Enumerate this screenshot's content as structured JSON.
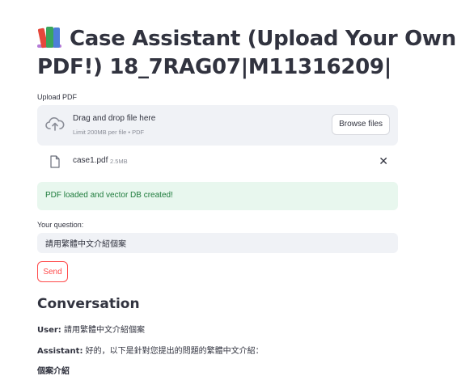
{
  "header": {
    "title": "Case Assistant (Upload Your Own PDF!) 18_7RAG07|M11316209|",
    "icon": "books-icon"
  },
  "upload": {
    "label": "Upload PDF",
    "drop_title": "Drag and drop file here",
    "drop_subtitle": "Limit 200MB per file • PDF",
    "browse_label": "Browse files",
    "file": {
      "name": "case1.pdf",
      "size": "2.5MB"
    }
  },
  "status": {
    "message": "PDF loaded and vector DB created!",
    "color": "#1e7b3c"
  },
  "question": {
    "label": "Your question:",
    "value": "請用繁體中文介紹個案"
  },
  "send_label": "Send",
  "conversation": {
    "title": "Conversation",
    "messages": [
      {
        "role": "User:",
        "text": "請用繁體中文介紹個案"
      },
      {
        "role": "Assistant:",
        "text": "好的，以下是針對您提出的問題的繁體中文介紹："
      }
    ],
    "next_heading": "個案介紹"
  },
  "colors": {
    "accent": "#ff4b4b",
    "text": "#31333f",
    "input_bg": "#f0f2f6"
  }
}
